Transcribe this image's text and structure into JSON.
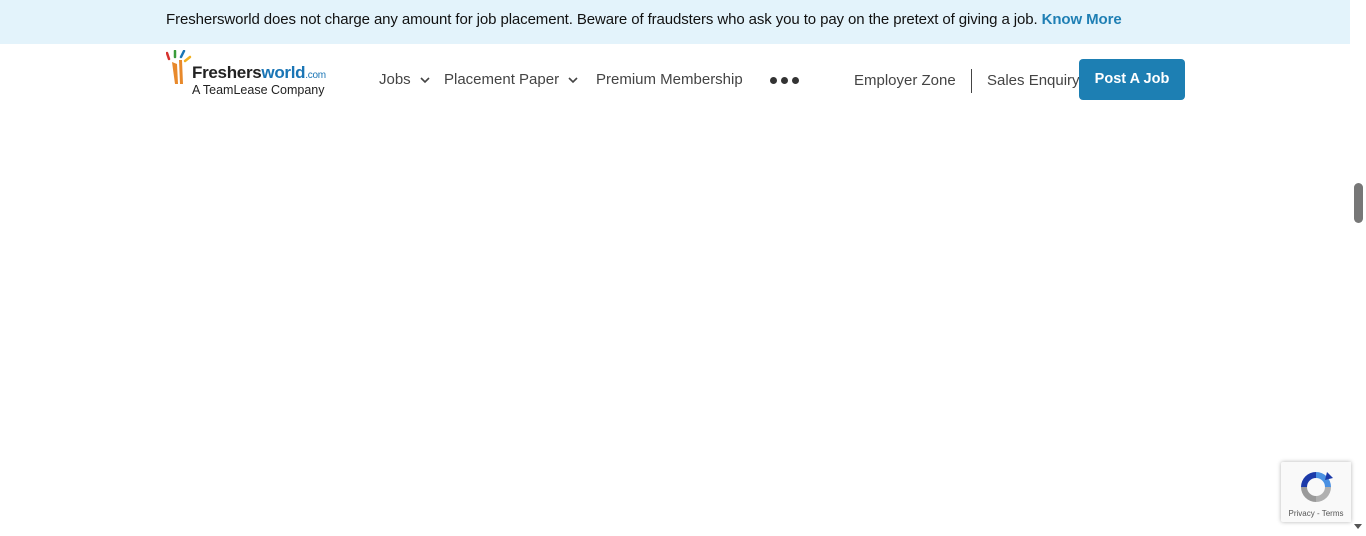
{
  "notice": {
    "message": "Freshersworld does not charge any amount for job placement. Beware of fraudsters who ask you to pay on the pretext of giving a job.",
    "link_label": "Know More"
  },
  "logo": {
    "brand_part1": "Freshers",
    "brand_part2": "world",
    "suffix": ".com",
    "tagline": "A TeamLease Company"
  },
  "nav": {
    "jobs": "Jobs",
    "placement_paper": "Placement Paper",
    "premium_membership": "Premium Membership",
    "more_icon": "more-dots-icon"
  },
  "right_nav": {
    "employer_zone": "Employer Zone",
    "sales_enquiry": "Sales Enquiry",
    "post_job": "Post A Job"
  },
  "recaptcha": {
    "privacy": "Privacy",
    "separator": " - ",
    "terms": "Terms"
  },
  "colors": {
    "notice_bg": "#e3f3fb",
    "accent": "#1d7fb3",
    "link": "#1f7fb4"
  }
}
